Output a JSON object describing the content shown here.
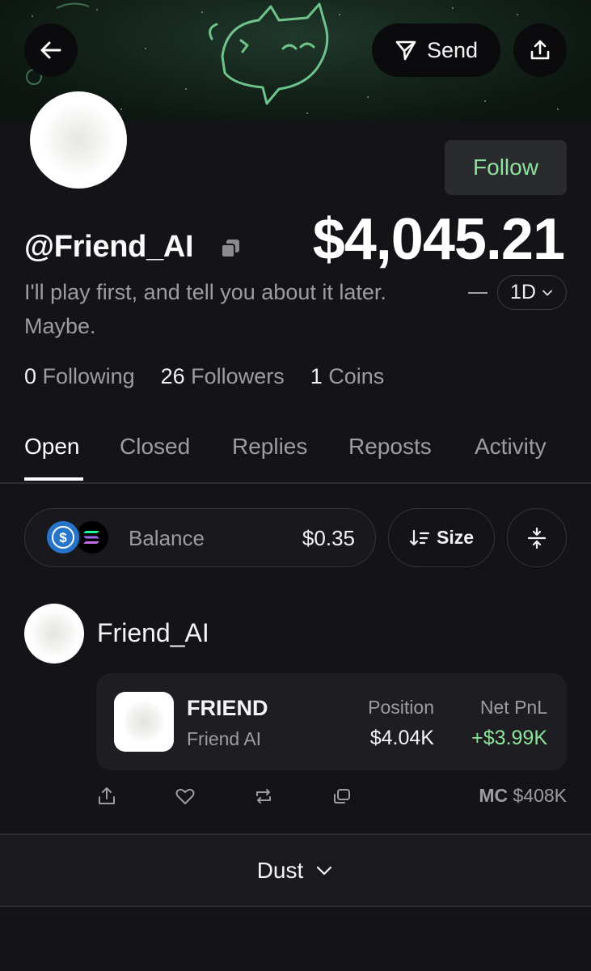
{
  "header": {
    "send_label": "Send"
  },
  "profile": {
    "handle": "@Friend_AI",
    "follow_label": "Follow",
    "portfolio_value": "$4,045.21",
    "bio": "I'll play first, and tell you about it later. Maybe.",
    "range_label": "1D",
    "stats": {
      "following_count": "0",
      "following_label": "Following",
      "followers_count": "26",
      "followers_label": "Followers",
      "coins_count": "1",
      "coins_label": "Coins"
    }
  },
  "tabs": [
    {
      "label": "Open",
      "active": true
    },
    {
      "label": "Closed",
      "active": false
    },
    {
      "label": "Replies",
      "active": false
    },
    {
      "label": "Reposts",
      "active": false
    },
    {
      "label": "Activity",
      "active": false
    }
  ],
  "controls": {
    "balance_label": "Balance",
    "balance_value": "$0.35",
    "sort_label": "Size"
  },
  "holding": {
    "user_name": "Friend_AI",
    "coin_ticker": "FRIEND",
    "coin_name": "Friend AI",
    "position_label": "Position",
    "position_value": "$4.04K",
    "pnl_label": "Net PnL",
    "pnl_value": "+$3.99K",
    "mc_label": "MC",
    "mc_value": "$408K"
  },
  "footer": {
    "dust_label": "Dust"
  },
  "colors": {
    "background": "#141418",
    "accent_green": "#8ee39a",
    "muted_text": "#9c9ca3",
    "usdc_blue": "#2775ca"
  },
  "icons": [
    "back-arrow-icon",
    "send-icon",
    "share-icon",
    "copy-icon",
    "chevron-down-icon",
    "usdc-icon",
    "solana-icon",
    "sort-icon",
    "collapse-icon",
    "share-icon",
    "heart-icon",
    "repost-icon",
    "quote-icon"
  ]
}
